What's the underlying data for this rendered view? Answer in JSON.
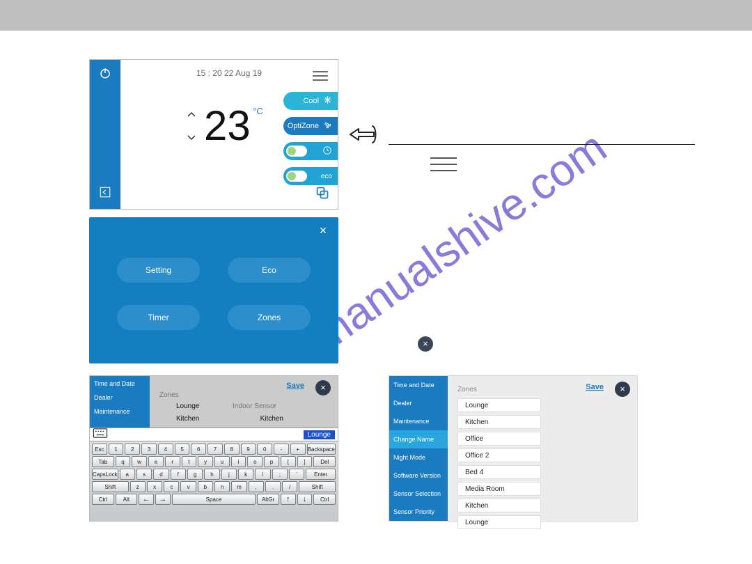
{
  "watermark": "manualshive.com",
  "colors": {
    "brand": "#1b7bc0",
    "accent": "#2aa6df",
    "cool": "#2ab5d6",
    "dark": "#2f3b4a"
  },
  "thermo": {
    "timestamp": "15 : 20 22 Aug 19",
    "temp": "23",
    "unit": "°C",
    "pills": {
      "cool": "Cool",
      "optizone": "OptiZone",
      "eco": "eco"
    },
    "icons": {
      "power": "power-icon",
      "collapse": "collapse-icon",
      "hamburger": "hamburger-icon",
      "clock": "clock-icon",
      "fan": "fan-icon",
      "snow": "snowflake-icon",
      "zones": "zones-icon"
    }
  },
  "menu": {
    "buttons": {
      "setting": "Setting",
      "eco": "Eco",
      "timer": "Timer",
      "zones": "Zones"
    }
  },
  "kbd_panel": {
    "side_menu": [
      "Time and Date",
      "Dealer",
      "Maintenance"
    ],
    "save_label": "Save",
    "section_label": "Zones",
    "sensor_label": "Indoor Sensor",
    "zone_row1": "Lounge",
    "zone_row2": "Kitchen",
    "sensor_row2": "Kitchen",
    "edit_value": "Lounge",
    "keyboard": {
      "row1": [
        "Esc",
        "1",
        "2",
        "3",
        "4",
        "5",
        "6",
        "7",
        "8",
        "9",
        "0",
        "-",
        "+",
        "Backspace"
      ],
      "row2": [
        "Tab",
        "q",
        "w",
        "e",
        "r",
        "t",
        "y",
        "u",
        "i",
        "o",
        "p",
        "[",
        "]",
        "Del"
      ],
      "row3": [
        "CapsLock",
        "a",
        "s",
        "d",
        "f",
        "g",
        "h",
        "j",
        "k",
        "l",
        ";",
        "'",
        "Enter"
      ],
      "row4": [
        "Shift",
        "z",
        "x",
        "c",
        "v",
        "b",
        "n",
        "m",
        ",",
        ".",
        "/",
        "Shift"
      ],
      "row5": [
        "Ctrl",
        "Alt",
        "Space",
        "AltGr",
        "Ctrl"
      ],
      "arrows": [
        "←",
        "→",
        "↑",
        "↓"
      ]
    }
  },
  "zones_panel": {
    "save_label": "Save",
    "title": "Zones",
    "menu": [
      "Time and Date",
      "Dealer",
      "Maintenance",
      "Change Name",
      "Night Mode",
      "Software Version",
      "Sensor Selection",
      "Sensor Priority"
    ],
    "active_menu_index": 3,
    "zones": [
      "Lounge",
      "Kitchen",
      "Office",
      "Office 2",
      "Bed 4",
      "Media Room",
      "Kitchen",
      "Lounge"
    ]
  }
}
